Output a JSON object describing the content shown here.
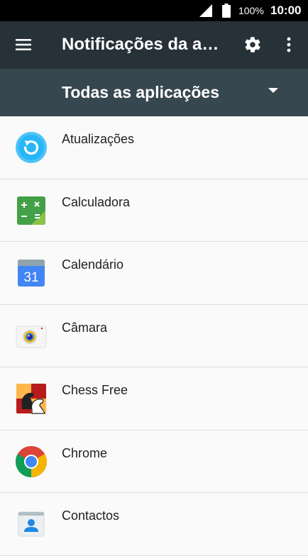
{
  "status_bar": {
    "battery_percent": "100%",
    "time": "10:00"
  },
  "app_bar": {
    "title": "Notificações da aplicações",
    "menu_icon": "hamburger-menu-icon",
    "settings_icon": "gear-icon",
    "more_icon": "more-vertical-icon"
  },
  "filter": {
    "selected": "Todas as aplicações",
    "icon": "dropdown-arrow-icon"
  },
  "apps": [
    {
      "name": "Atualizações",
      "icon": "updates-icon"
    },
    {
      "name": "Calculadora",
      "icon": "calculator-icon"
    },
    {
      "name": "Calendário",
      "icon": "calendar-icon",
      "icon_text": "31"
    },
    {
      "name": "Câmara",
      "icon": "camera-icon"
    },
    {
      "name": "Chess Free",
      "icon": "chess-icon"
    },
    {
      "name": "Chrome",
      "icon": "chrome-icon"
    },
    {
      "name": "Contactos",
      "icon": "contacts-icon"
    }
  ],
  "colors": {
    "app_bar": "#263238",
    "filter_bar": "#37474f",
    "list_background": "#fafafa"
  }
}
